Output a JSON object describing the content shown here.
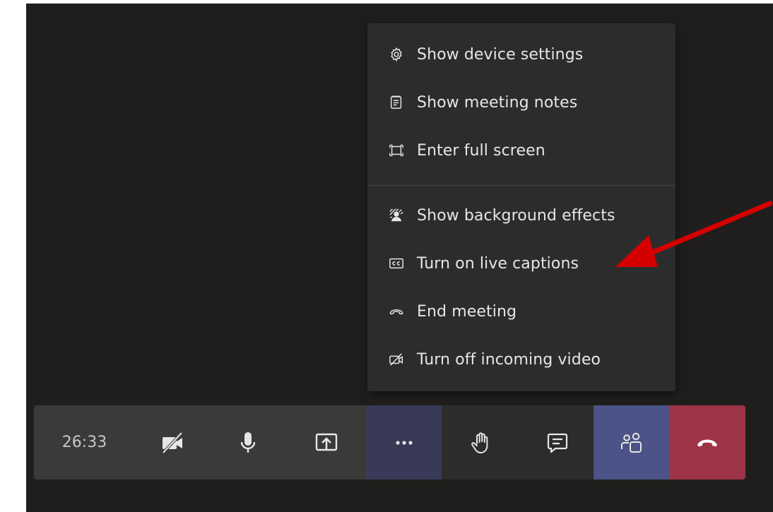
{
  "menu": {
    "group1": [
      {
        "icon": "gear-icon",
        "label": "Show device settings"
      },
      {
        "icon": "notes-icon",
        "label": "Show meeting notes"
      },
      {
        "icon": "fullscreen-icon",
        "label": "Enter full screen"
      }
    ],
    "group2": [
      {
        "icon": "background-effects-icon",
        "label": "Show background effects"
      },
      {
        "icon": "closed-captions-icon",
        "label": "Turn on live captions"
      },
      {
        "icon": "end-call-icon",
        "label": "End meeting"
      },
      {
        "icon": "video-off-icon",
        "label": "Turn off incoming video"
      }
    ]
  },
  "toolbar": {
    "timer": "26:33",
    "buttons": [
      "camera-off-icon",
      "microphone-icon",
      "share-screen-icon",
      "more-options-icon",
      "raise-hand-icon",
      "chat-icon",
      "participants-icon",
      "hang-up-icon"
    ]
  },
  "colors": {
    "meeting_bg": "#1f1e1d",
    "menu_bg": "#2d2c2c",
    "more_button_bg": "#383a57",
    "participants_bg": "#4b5387",
    "hangup_bg": "#9e3447",
    "arrow": "#d40000"
  }
}
